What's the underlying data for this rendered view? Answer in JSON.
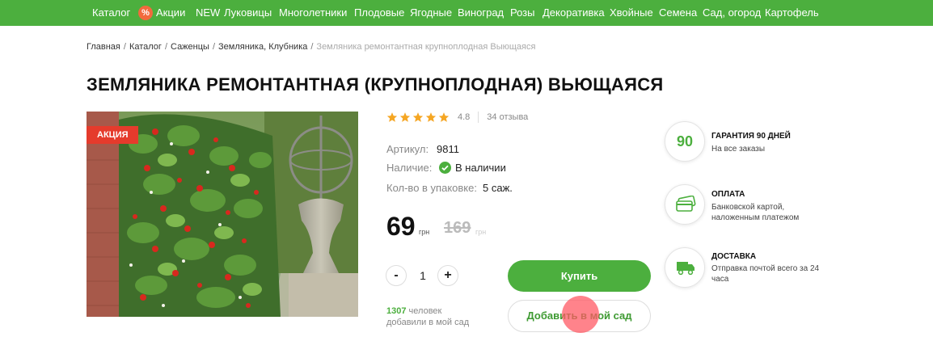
{
  "nav": {
    "items": [
      "Каталог",
      "Акции",
      "NEW",
      "Луковицы",
      "Многолетники",
      "Плодовые",
      "Ягодные",
      "Виноград",
      "Розы",
      "Декоративка",
      "Хвойные",
      "Семена",
      "Сад, огород",
      "Картофель"
    ],
    "promo_badge": "%"
  },
  "breadcrumb": [
    "Главная",
    "Каталог",
    "Саженцы",
    "Земляника, Клубника",
    "Земляника ремонтантная крупноплодная Выющаяся"
  ],
  "product": {
    "title": "ЗЕМЛЯНИКА РЕМОНТАНТНАЯ (КРУПНОПЛОДНАЯ) ВЬЮЩАЯСЯ",
    "badge": "АКЦИЯ",
    "rating": {
      "stars": 5,
      "value": "4.8",
      "reviews": "34 отзыва"
    },
    "specs": {
      "article_label": "Артикул:",
      "article_value": "9811",
      "availability_label": "Наличие:",
      "availability_value": "В наличии",
      "pack_label": "Кол-во в упаковке:",
      "pack_value": "5 саж."
    },
    "price": {
      "current": "69",
      "currency": "грн",
      "old": "169"
    },
    "quantity": {
      "minus": "-",
      "value": "1",
      "plus": "+"
    },
    "in_garden": {
      "count": "1307",
      "suffix": "человек",
      "line2": "добавили в мой сад"
    },
    "buy_label": "Купить",
    "garden_label": "Добавить в мой сад"
  },
  "features": [
    {
      "icon": "90",
      "title": "ГАРАНТИЯ 90 ДНЕЙ",
      "lines": [
        "На все заказы"
      ]
    },
    {
      "icon": "card-icon",
      "title": "ОПЛАТА",
      "lines": [
        "Банковской картой,",
        "наложенным платежом"
      ]
    },
    {
      "icon": "truck-icon",
      "title": "ДОСТАВКА",
      "lines": [
        "Отправка почтой всего за 24",
        "часа"
      ]
    }
  ],
  "colors": {
    "brand_green": "#4caf3e",
    "sale_red": "#e53b2c",
    "promo_orange": "#f26a3d",
    "star": "#f5a623"
  }
}
